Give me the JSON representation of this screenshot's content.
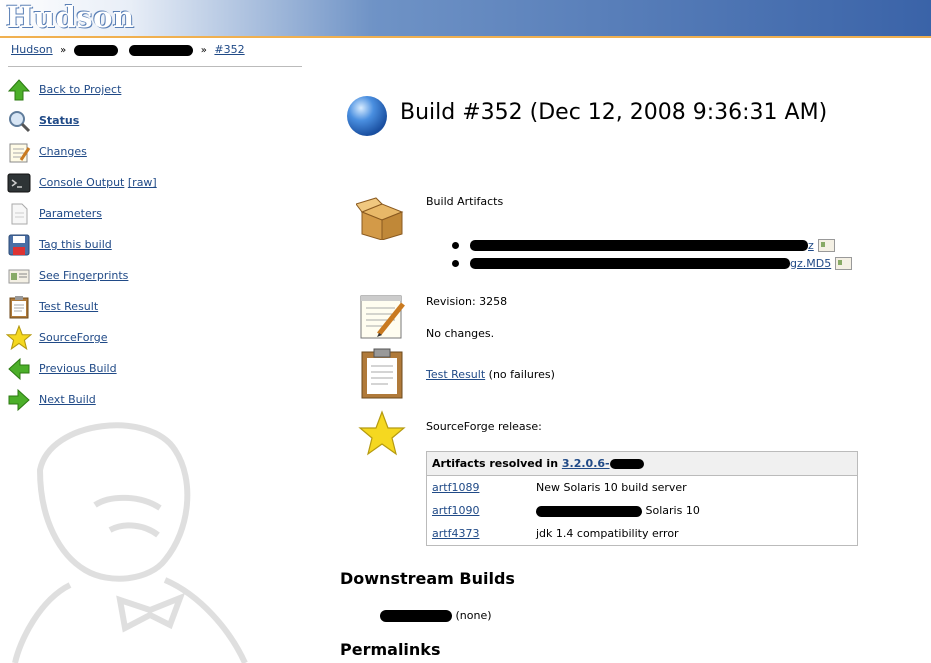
{
  "header": {
    "logo": "Hudson"
  },
  "breadcrumb": {
    "root": "Hudson",
    "sep": "»",
    "build": "#352"
  },
  "sidebar": {
    "items": [
      {
        "label": "Back to Project",
        "icon": "up-arrow-icon"
      },
      {
        "label": "Status",
        "icon": "magnifier-icon",
        "bold": true
      },
      {
        "label": "Changes",
        "icon": "notepad-icon"
      },
      {
        "label": "Console Output",
        "extra": "[raw]",
        "icon": "terminal-icon"
      },
      {
        "label": "Parameters",
        "icon": "document-icon"
      },
      {
        "label": "Tag this build",
        "icon": "save-icon"
      },
      {
        "label": "See Fingerprints",
        "icon": "fingerprint-icon"
      },
      {
        "label": "Test Result",
        "icon": "clipboard-icon"
      },
      {
        "label": "SourceForge",
        "icon": "star-icon"
      },
      {
        "label": "Previous Build",
        "icon": "left-arrow-icon"
      },
      {
        "label": "Next Build",
        "icon": "right-arrow-icon"
      }
    ]
  },
  "main": {
    "title": "Build #352 (Dec 12, 2008 9:36:31 AM)",
    "artifacts_heading": "Build Artifacts",
    "artifacts": [
      {
        "suffix": "z"
      },
      {
        "suffix": "gz.MD5"
      }
    ],
    "revision": "Revision: 3258",
    "no_changes": "No changes.",
    "test_result_link": "Test Result",
    "test_result_status": "(no failures)",
    "sourceforge_release": "SourceForge release:",
    "table": {
      "heading_prefix": "Artifacts resolved in",
      "heading_link": "3.2.0.6-",
      "rows": [
        {
          "id": "artf1089",
          "desc": "New Solaris 10 build server"
        },
        {
          "id": "artf1090",
          "desc": "Solaris 10"
        },
        {
          "id": "artf4373",
          "desc": "jdk 1.4 compatibility error"
        }
      ]
    },
    "downstream_heading": "Downstream Builds",
    "downstream_none": "(none)",
    "permalinks_heading": "Permalinks"
  }
}
